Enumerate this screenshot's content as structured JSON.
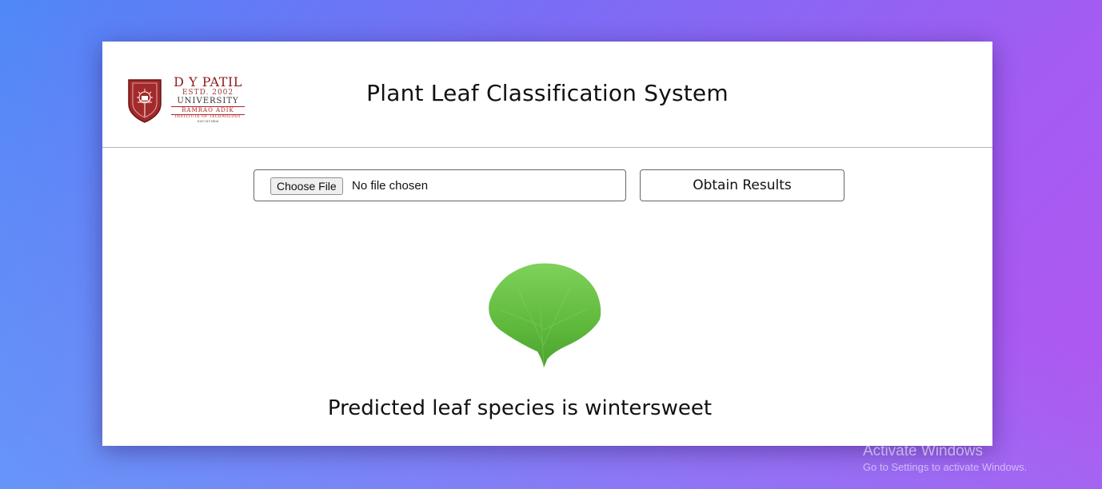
{
  "header": {
    "logo": {
      "line1": "D Y PATIL",
      "line2": "ESTD. 2002",
      "line3": "UNIVERSITY",
      "line4": "RAMRAO ADIK",
      "line5": "INSTITUTE OF TECHNOLOGY",
      "line6": "NAVI MUMBAI"
    },
    "title": "Plant Leaf Classification System"
  },
  "form": {
    "choose_file_label": "Choose File",
    "no_file_text": "No file chosen",
    "obtain_results_label": "Obtain Results"
  },
  "result": {
    "leaf_image": "ginkgo-leaf",
    "prediction_text": "Predicted leaf species is wintersweet"
  },
  "watermark": {
    "title": "Activate Windows",
    "subtitle": "Go to Settings to activate Windows."
  },
  "colors": {
    "accent_logo": "#8e1b1b",
    "leaf_green": "#6cc24a"
  }
}
